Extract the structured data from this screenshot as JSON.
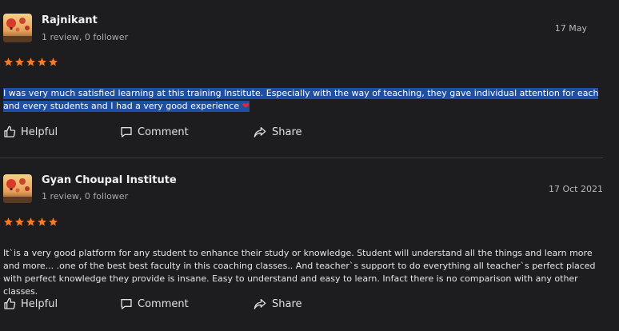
{
  "reviews": [
    {
      "name": "Rajnikant",
      "meta": "1 review, 0 follower",
      "date": "17 May",
      "rating": 5,
      "text": "I was very much satisfied learning at this training Institute. Especially with the way of teaching, they gave individual attention for each and every students and I had a very good experience",
      "text_highlighted": true,
      "emoji": "❤"
    },
    {
      "name": "Gyan Choupal Institute",
      "meta": "1 review, 0 follower",
      "date": "17 Oct 2021",
      "rating": 5,
      "text": "It`is a very good platform for any student to enhance their study or knowledge. Student will understand all the things and learn more and more... .one of the best best faculty in this coaching classes.. And teacher`s support to do everything all teacher`s perfect placed with perfect knowledge they provide is insane. Easy to understand and easy to learn. Infact there is no comparison with any other classes.",
      "text_highlighted": false
    }
  ],
  "actions": {
    "helpful_label": "Helpful",
    "comment_label": "Comment",
    "share_label": "Share"
  },
  "colors": {
    "background": "#1d1d1f",
    "star": "#f47b2a",
    "highlight": "#1e4fa3",
    "heart": "#e0263b"
  },
  "icons": [
    "thumbs-up-icon",
    "comment-icon",
    "share-icon",
    "star-icon",
    "heart-icon"
  ]
}
